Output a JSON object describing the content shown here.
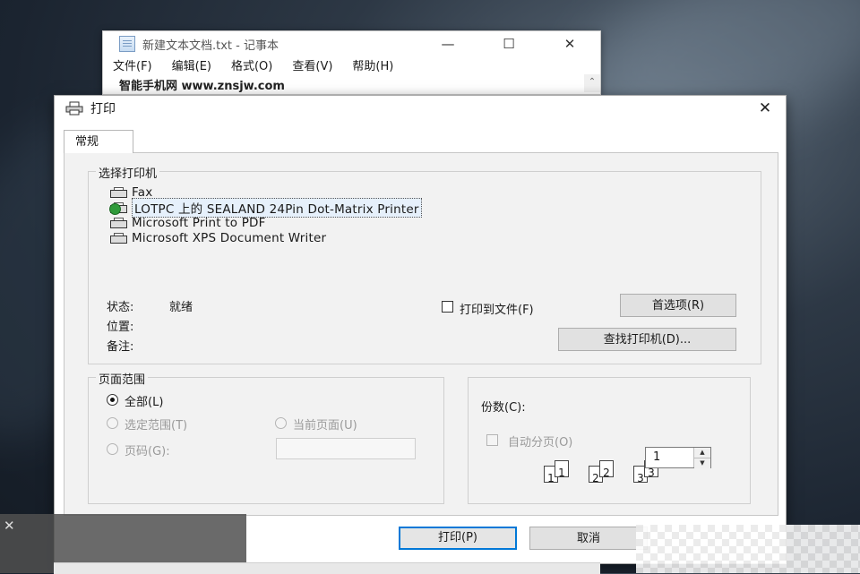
{
  "notepad": {
    "title": "新建文本文档.txt - 记事本",
    "controls": {
      "minimize": "—",
      "maximize": "☐",
      "close": "✕"
    },
    "menu": [
      "文件(F)",
      "编辑(E)",
      "格式(O)",
      "查看(V)",
      "帮助(H)"
    ],
    "content": "智能手机网 www.znsjw.com",
    "scroll_up": "⌃"
  },
  "dialog": {
    "title": "打印",
    "close": "✕",
    "tab": "常规",
    "select_printer_label": "选择打印机",
    "printers": [
      {
        "name": "Fax",
        "icon": "fax-printer-icon"
      },
      {
        "name": "LOTPC 上的 SEALAND 24Pin Dot-Matrix Printer",
        "icon": "default-printer-icon",
        "selected": true
      },
      {
        "name": "Microsoft Print to PDF",
        "icon": "printer-icon"
      },
      {
        "name": "Microsoft XPS Document Writer",
        "icon": "printer-icon"
      }
    ],
    "status_label": "状态:",
    "status_value": "就绪",
    "location_label": "位置:",
    "comment_label": "备注:",
    "print_to_file_label": "打印到文件(F)",
    "preferences_button": "首选项(R)",
    "find_printer_button": "查找打印机(D)...",
    "page_range": {
      "label": "页面范围",
      "all": "全部(L)",
      "selection": "选定范围(T)",
      "current_page": "当前页面(U)",
      "pages": "页码(G):",
      "pages_value": ""
    },
    "copies": {
      "label": "份数(C):",
      "value": "1",
      "collate_label": "自动分页(O)",
      "collate_pages": [
        "1",
        "1",
        "2",
        "2",
        "3",
        "3"
      ]
    },
    "print_button": "打印(P)",
    "cancel_button": "取消"
  },
  "overlay": {
    "close": "✕"
  }
}
